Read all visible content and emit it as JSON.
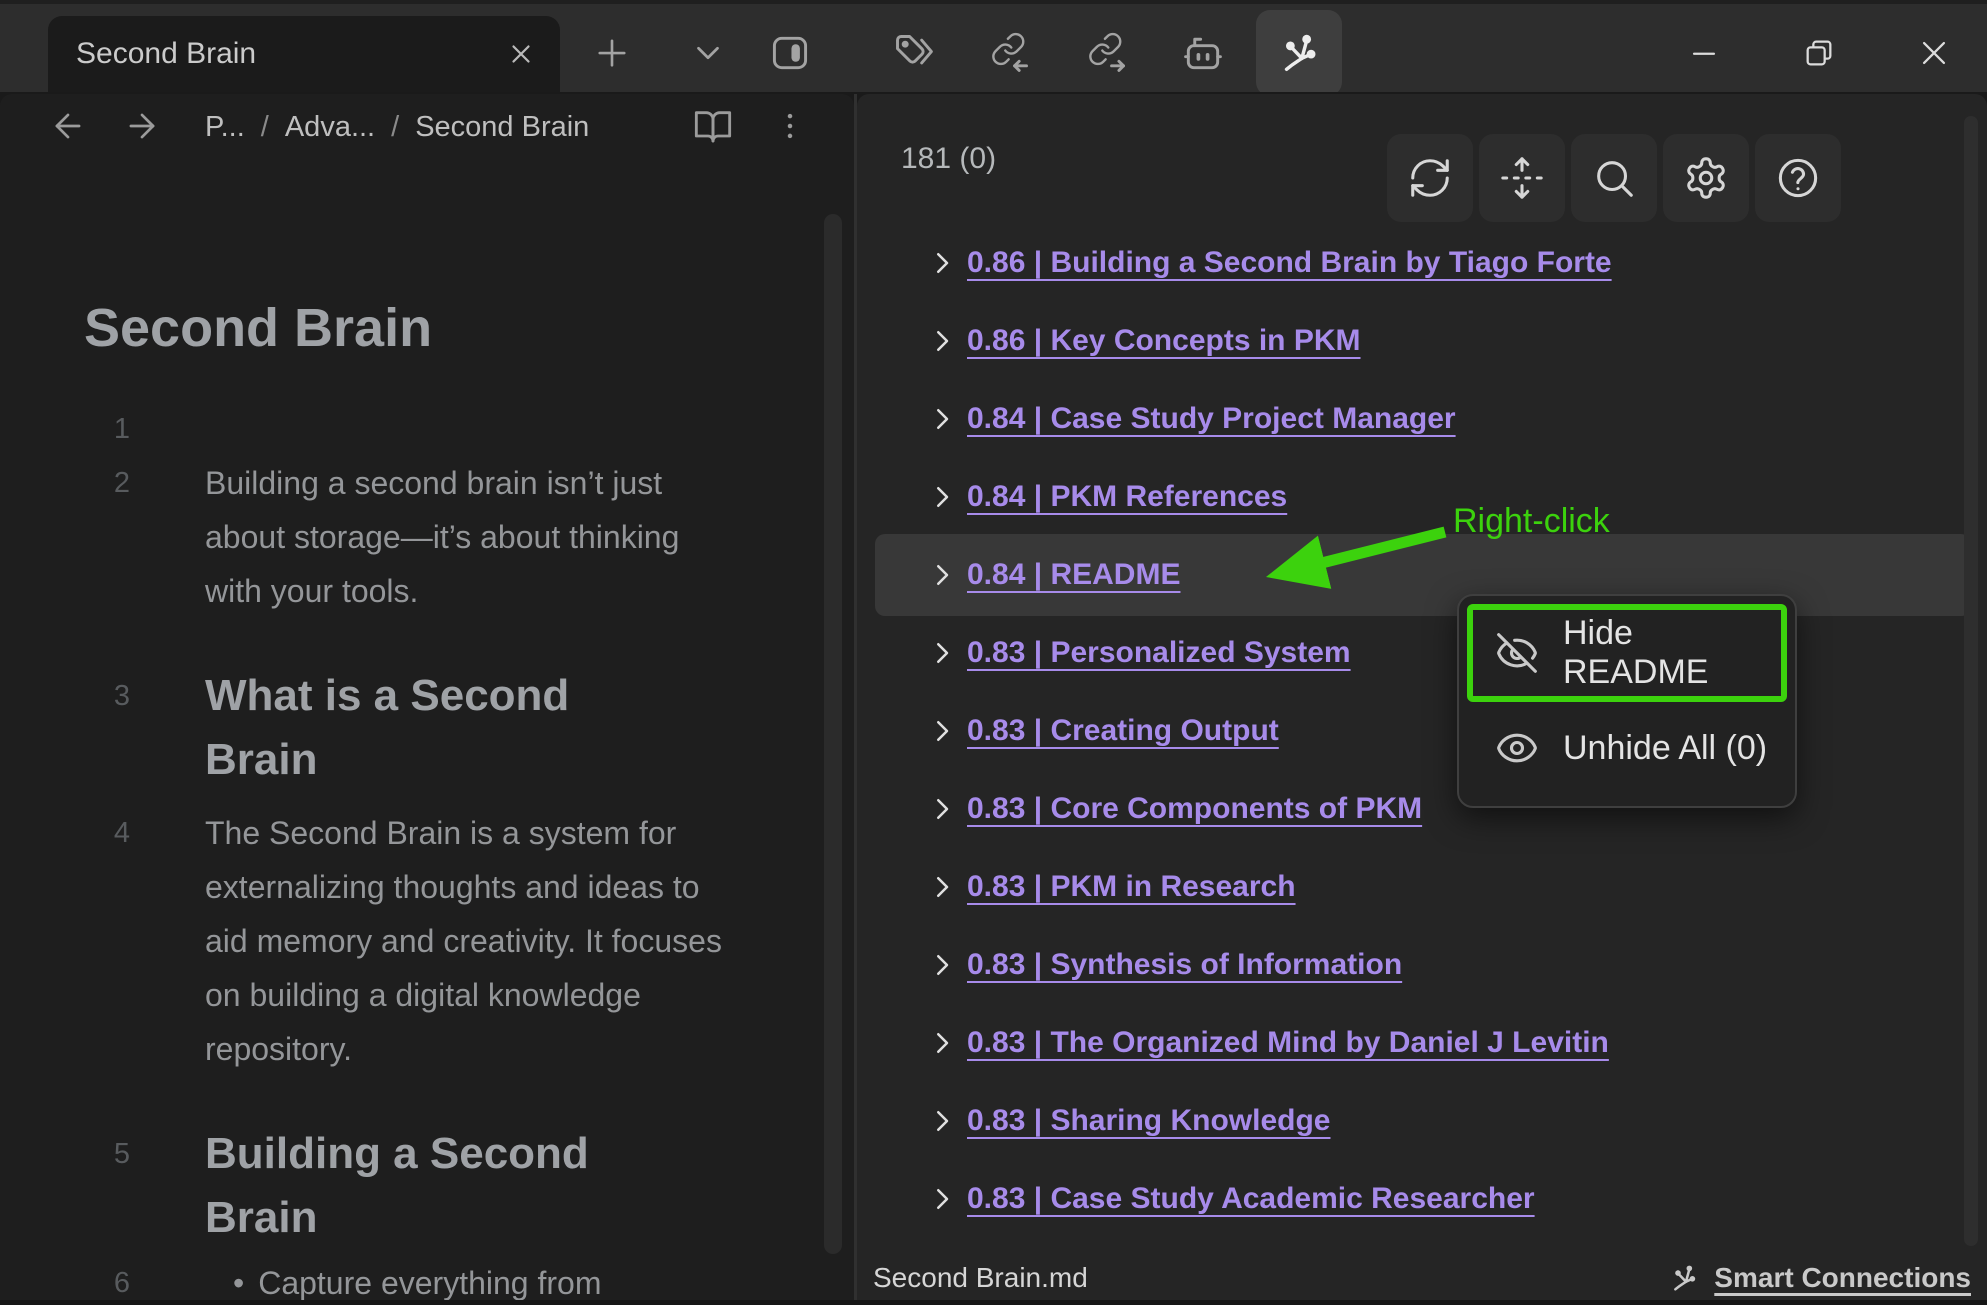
{
  "titlebar": {
    "tab_title": "Second Brain",
    "icon_names": [
      "close-tab",
      "new-tab",
      "tab-list-chevron",
      "toggle-right-sidebar",
      "tags",
      "incoming-links",
      "outgoing-links",
      "bot",
      "smart-connections-view"
    ],
    "window_controls": [
      "minimize",
      "restore",
      "close"
    ]
  },
  "editor": {
    "breadcrumb": {
      "items": [
        "P...",
        "Adva...",
        "Second Brain"
      ],
      "separator": "/"
    },
    "title": "Second Brain",
    "lines": [
      {
        "num": "1",
        "text": ""
      },
      {
        "num": "2",
        "text": "Building a second brain isn’t just about storage—it’s about thinking with your tools."
      },
      {
        "num": "3",
        "text": "What is a Second Brain"
      },
      {
        "num": "4",
        "text": "The Second Brain is a system for externalizing thoughts and ideas to aid memory and creativity. It focuses on building a digital knowledge repository."
      },
      {
        "num": "5",
        "text": "Building a Second Brain"
      },
      {
        "num": "6",
        "bullet": "•",
        "text": "Capture everything from"
      }
    ]
  },
  "connections": {
    "count_label": "181 (0)",
    "toolbar_icons": [
      "refresh",
      "fold-expand",
      "search",
      "settings",
      "help"
    ],
    "items": [
      "0.86 | Building a Second Brain by Tiago Forte",
      "0.86 | Key Concepts in PKM",
      "0.84 | Case Study Project Manager",
      "0.84 | PKM References",
      "0.84 | README",
      "0.83 | Personalized System",
      "0.83 | Creating Output",
      "0.83 | Core Components of PKM",
      "0.83 | PKM in Research",
      "0.83 | Synthesis of Information",
      "0.83 | The Organized Mind by Daniel J Levitin",
      "0.83 | Sharing Knowledge",
      "0.83 | Case Study Academic Researcher"
    ],
    "highlighted_item": "0.84 | README",
    "footer_file": "Second Brain.md",
    "footer_link": "Smart Connections"
  },
  "context_menu": {
    "items": [
      {
        "icon": "eye-off",
        "label": "Hide README",
        "highlighted": true
      },
      {
        "icon": "eye",
        "label": "Unhide All (0)",
        "highlighted": false
      }
    ]
  },
  "annotation": {
    "label": "Right-click"
  },
  "colors": {
    "accent_link": "#a78bea",
    "annotation_green": "#3cd20d",
    "row_highlight": "#383838",
    "titlebar_bg": "#2d2d2d",
    "pane_bg_left": "#1e1e1e",
    "pane_bg_right": "#252525"
  }
}
